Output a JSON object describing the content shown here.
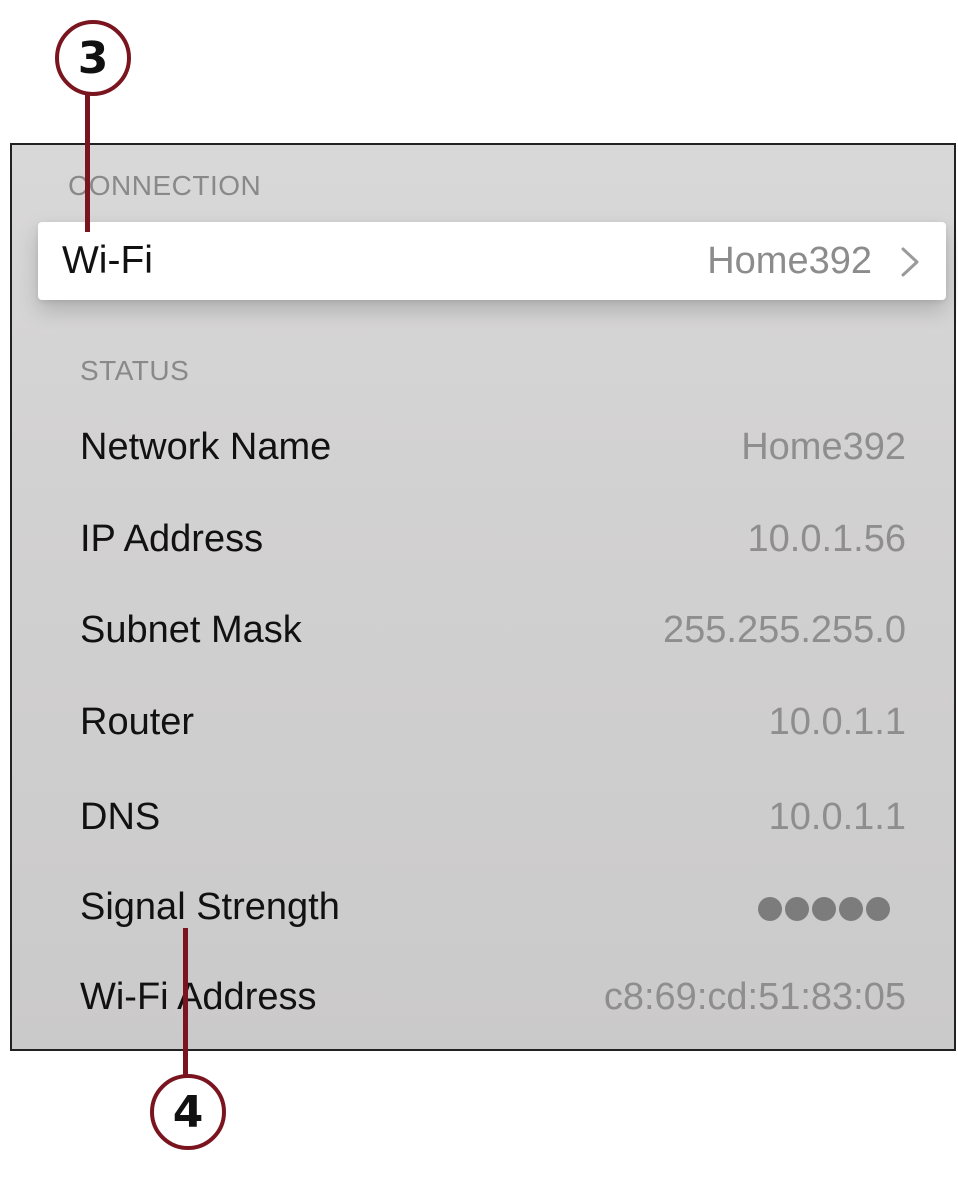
{
  "connection": {
    "header": "CONNECTION",
    "wifi": {
      "label": "Wi-Fi",
      "value": "Home392",
      "chevron_icon": "chevron-right-icon"
    }
  },
  "status": {
    "header": "STATUS",
    "network_name": {
      "label": "Network Name",
      "value": "Home392"
    },
    "ip_address": {
      "label": "IP Address",
      "value": "10.0.1.56"
    },
    "subnet_mask": {
      "label": "Subnet Mask",
      "value": "255.255.255.0"
    },
    "router": {
      "label": "Router",
      "value": "10.0.1.1"
    },
    "dns": {
      "label": "DNS",
      "value": "10.0.1.1"
    },
    "signal_strength": {
      "label": "Signal Strength",
      "bars": 5,
      "max_bars": 5
    },
    "wifi_address": {
      "label": "Wi-Fi Address",
      "value": "c8:69:cd:51:83:05"
    }
  },
  "callouts": {
    "top": "3",
    "bottom": "4"
  },
  "colors": {
    "callout": "#7a1520",
    "highlight": "#ffffff",
    "panel": "#d4d3d3"
  }
}
